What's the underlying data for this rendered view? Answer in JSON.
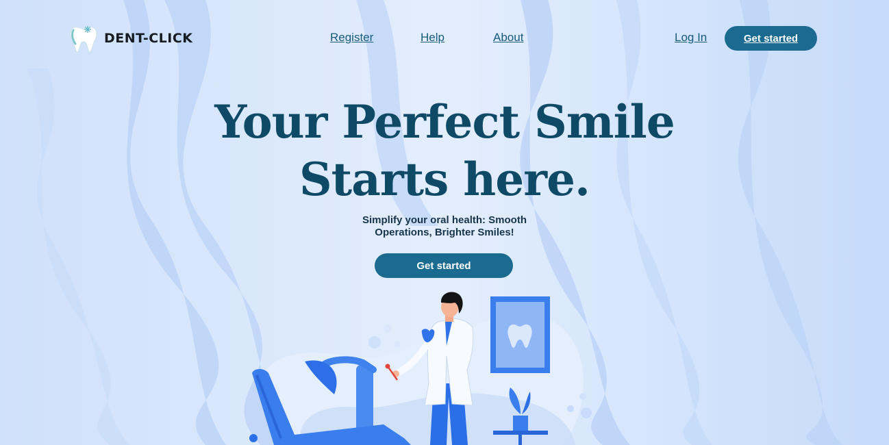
{
  "brand": {
    "name": "DENT-CLICK",
    "logo_icon": "tooth-icon"
  },
  "nav": {
    "links": [
      {
        "label": "Register"
      },
      {
        "label": "Help"
      },
      {
        "label": "About"
      }
    ],
    "login_label": "Log In",
    "cta_label": "Get started"
  },
  "hero": {
    "title_line1": "Your Perfect Smile",
    "title_line2": "Starts here.",
    "subtitle_line1": "Simplify your oral health: Smooth",
    "subtitle_line2": "Operations, Brighter Smiles!",
    "cta_label": "Get started"
  },
  "colors": {
    "accent": "#1b6b91",
    "heading": "#0e4a66",
    "background": "#d6e6fb"
  }
}
